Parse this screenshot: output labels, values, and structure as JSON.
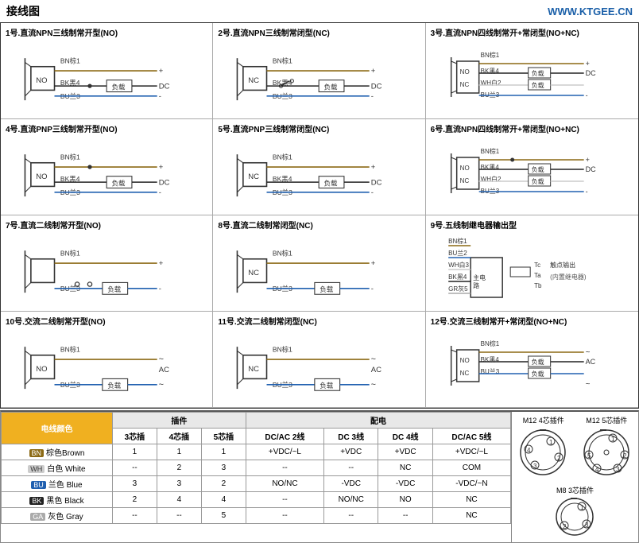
{
  "header": {
    "title": "接线图",
    "url": "WWW.KTGEE.CN"
  },
  "diagrams": [
    {
      "id": 1,
      "title": "1号.直流NPN三线制常开型(NO)",
      "type": "npn-no-3wire",
      "wires": [
        "BN棕1",
        "BK黑4",
        "BU兰3"
      ],
      "labels": [
        "NO",
        "负载",
        "DC"
      ]
    },
    {
      "id": 2,
      "title": "2号.直流NPN三线制常闭型(NC)",
      "type": "npn-nc-3wire",
      "wires": [
        "BN棕1",
        "BK黑4",
        "BU兰3"
      ],
      "labels": [
        "NC",
        "负载",
        "DC"
      ]
    },
    {
      "id": 3,
      "title": "3号.直流NPN四线制常开+常闭型(NO+NC)",
      "type": "npn-nonc-4wire",
      "wires": [
        "BN棕1",
        "BK黑4",
        "WH白2",
        "BU兰3"
      ],
      "labels": [
        "NO",
        "NC",
        "负载",
        "负载",
        "DC"
      ]
    },
    {
      "id": 4,
      "title": "4号.直流PNP三线制常开型(NO)",
      "type": "pnp-no-3wire",
      "wires": [
        "BN棕1",
        "BK黑4",
        "BU兰3"
      ],
      "labels": [
        "NO",
        "负载",
        "DC"
      ]
    },
    {
      "id": 5,
      "title": "5号.直流PNP三线制常闭型(NC)",
      "type": "pnp-nc-3wire",
      "wires": [
        "BN棕1",
        "BK黑4",
        "BU兰3"
      ],
      "labels": [
        "NC",
        "负载",
        "DC"
      ]
    },
    {
      "id": 6,
      "title": "6号.直流NPN四线制常开+常闭型(NO+NC)",
      "type": "pnp-nonc-4wire",
      "wires": [
        "BN棕1",
        "BK黑4",
        "WH白2",
        "BU兰3"
      ],
      "labels": [
        "NO",
        "NC",
        "负载",
        "负载",
        "DC"
      ]
    },
    {
      "id": 7,
      "title": "7号.直流二线制常开型(NO)",
      "type": "2wire-no",
      "wires": [
        "BN棕1",
        "BU兰3"
      ],
      "labels": [
        "负载"
      ]
    },
    {
      "id": 8,
      "title": "8号.直流二线制常闭型(NC)",
      "type": "2wire-nc",
      "wires": [
        "BN棕1",
        "BU兰3"
      ],
      "labels": [
        "NC",
        "负载"
      ]
    },
    {
      "id": 9,
      "title": "9号.五线制继电器输出型",
      "type": "relay-5wire",
      "wires": [
        "BN棕1",
        "BU兰2",
        "WH白3",
        "BK黑4",
        "GR灰5"
      ],
      "labels": [
        "主电路",
        "Tc",
        "Ta",
        "Tb",
        "触点输出",
        "(内置继电器)"
      ]
    },
    {
      "id": 10,
      "title": "10号.交流二线制常开型(NO)",
      "type": "ac-2wire-no",
      "wires": [
        "BN棕1",
        "BU兰3"
      ],
      "labels": [
        "NO",
        "负载",
        "AC"
      ]
    },
    {
      "id": 11,
      "title": "11号.交流二线制常闭型(NC)",
      "type": "ac-2wire-nc",
      "wires": [
        "BN棕1",
        "BU兰3"
      ],
      "labels": [
        "NC",
        "负载",
        "AC"
      ]
    },
    {
      "id": 12,
      "title": "12号.交流三线制常开+常闭型(NO+NC)",
      "type": "ac-3wire-nonc",
      "wires": [
        "BN棕1",
        "BK黑4",
        "BU兰3"
      ],
      "labels": [
        "NO",
        "NC",
        "负载",
        "负载",
        "AC"
      ]
    }
  ],
  "table": {
    "section_headers": [
      "电线颜色",
      "插件",
      "配电"
    ],
    "plugin_headers": [
      "3芯插",
      "4芯插",
      "5芯插"
    ],
    "power_headers": [
      "DC/AC 2线",
      "DC 3线",
      "DC 4线",
      "DC/AC 5线"
    ],
    "rows": [
      {
        "code": "BN",
        "name": "棕色Brown",
        "color_class": "color-tag-bn",
        "c3": "1",
        "c4": "1",
        "c5": "1",
        "p2": "+VDC/~L",
        "p3": "+VDC",
        "p4": "+VDC",
        "p5": "+VDC/~L"
      },
      {
        "code": "WH",
        "name": "白色 White",
        "color_class": "color-tag-wh",
        "c3": "--",
        "c4": "2",
        "c5": "3",
        "p2": "--",
        "p3": "--",
        "p4": "NC",
        "p5": "COM"
      },
      {
        "code": "BU",
        "name": "兰色 Blue",
        "color_class": "color-tag-bu",
        "c3": "3",
        "c4": "3",
        "c5": "2",
        "p2": "NO/NC",
        "p3": "-VDC",
        "p4": "-VDC",
        "p5": "-VDC/~N"
      },
      {
        "code": "BK",
        "name": "黑色 Black",
        "color_class": "color-tag-bk",
        "c3": "2",
        "c4": "4",
        "c5": "4",
        "p2": "--",
        "p3": "NO/NC",
        "p4": "NO",
        "p5": "NC"
      },
      {
        "code": "GA",
        "name": "灰色 Gray",
        "color_class": "color-tag-ga",
        "c3": "--",
        "c4": "--",
        "c5": "5",
        "p2": "--",
        "p3": "--",
        "p4": "--",
        "p5": "NC"
      }
    ],
    "connector_labels": {
      "m12_4pin": "M12 4芯插件",
      "m12_5pin": "M12 5芯插件",
      "m8_3pin": "M8 3芯插件"
    }
  }
}
